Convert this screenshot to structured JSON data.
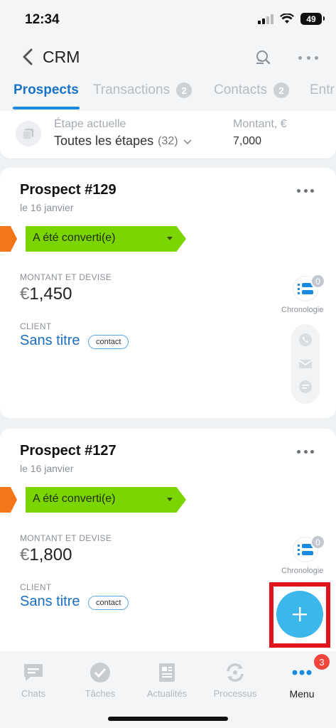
{
  "status_bar": {
    "time": "12:34",
    "battery": "49"
  },
  "header": {
    "title": "CRM"
  },
  "tabs": [
    {
      "label": "Prospects",
      "badge": ""
    },
    {
      "label": "Transactions",
      "badge": "2"
    },
    {
      "label": "Contacts",
      "badge": "2"
    },
    {
      "label": "Entr",
      "badge": ""
    }
  ],
  "filter": {
    "stage_label": "Étape actuelle",
    "stage_value": "Toutes les étapes",
    "stage_count": "(32)",
    "amount_label": "Montant, €",
    "amount_value": "7,000"
  },
  "cards": [
    {
      "title": "Prospect #129",
      "date": "le 16 janvier",
      "stage": "A été converti(e)",
      "amount_label": "MONTANT ET DEVISE",
      "currency": "€",
      "amount": "1,450",
      "client_label": "CLIENT",
      "client_name": "Sans titre",
      "client_tag": "contact",
      "timeline_count": "0",
      "timeline_label": "Chronologie"
    },
    {
      "title": "Prospect #127",
      "date": "le 16 janvier",
      "stage": "A été converti(e)",
      "amount_label": "MONTANT ET DEVISE",
      "currency": "€",
      "amount": "1,800",
      "client_label": "CLIENT",
      "client_name": "Sans titre",
      "client_tag": "contact",
      "timeline_count": "0",
      "timeline_label": "Chronologie"
    }
  ],
  "bottom_nav": {
    "items": [
      {
        "label": "Chats",
        "icon": "chat-icon"
      },
      {
        "label": "Tâches",
        "icon": "check-icon"
      },
      {
        "label": "Actualités",
        "icon": "news-icon"
      },
      {
        "label": "Processus",
        "icon": "process-icon"
      },
      {
        "label": "Menu",
        "icon": "menu-dots-icon"
      }
    ],
    "menu_badge": "3"
  },
  "colors": {
    "accent": "#1a8be0",
    "stage_green": "#7bd500",
    "stage_orange": "#f5761a",
    "fab": "#3cb7ec",
    "highlight": "#e1141e",
    "badge_red": "#f0463c"
  }
}
